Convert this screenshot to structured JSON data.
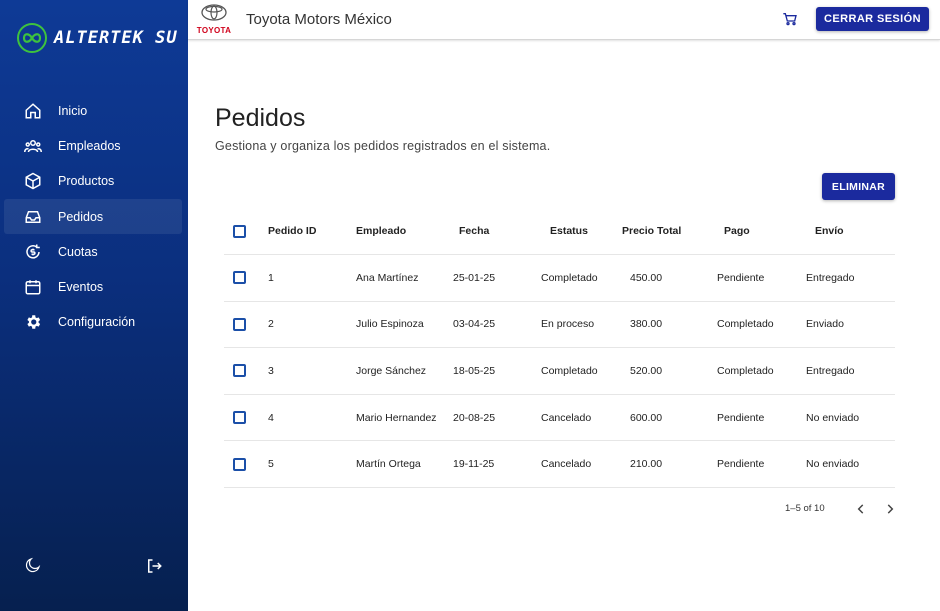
{
  "sidebar": {
    "logo_text": "ALTERTEK SU",
    "items": [
      {
        "label": "Inicio",
        "icon": "home-icon"
      },
      {
        "label": "Empleados",
        "icon": "people-icon"
      },
      {
        "label": "Productos",
        "icon": "box-icon"
      },
      {
        "label": "Pedidos",
        "icon": "inbox-icon",
        "active": true
      },
      {
        "label": "Cuotas",
        "icon": "dollar-refresh-icon"
      },
      {
        "label": "Eventos",
        "icon": "calendar-icon"
      },
      {
        "label": "Configuración",
        "icon": "gear-icon"
      }
    ]
  },
  "topbar": {
    "brand_word": "TOYOTA",
    "title": "Toyota Motors México",
    "logout_label": "CERRAR SESIÓN"
  },
  "main": {
    "title": "Pedidos",
    "subtitle": "Gestiona y organiza los pedidos registrados en el sistema.",
    "delete_label": "ELIMINAR"
  },
  "table": {
    "headers": [
      "Pedido ID",
      "Empleado",
      "Fecha",
      "Estatus",
      "Precio Total",
      "Pago",
      "Envío"
    ],
    "rows": [
      [
        "1",
        "Ana Martínez",
        "25-01-25",
        "Completado",
        "450.00",
        "Pendiente",
        "Entregado"
      ],
      [
        "2",
        "Julio Espinoza",
        "03-04-25",
        "En proceso",
        "380.00",
        "Completado",
        "Enviado"
      ],
      [
        "3",
        "Jorge Sánchez",
        "18-05-25",
        "Completado",
        "520.00",
        "Completado",
        "Entregado"
      ],
      [
        "4",
        "Mario Hernandez",
        "20-08-25",
        "Cancelado",
        "600.00",
        "Pendiente",
        "No enviado"
      ],
      [
        "5",
        "Martín Ortega",
        "19-11-25",
        "Cancelado",
        "210.00",
        "Pendiente",
        "No enviado"
      ]
    ]
  },
  "pagination": {
    "range": "1–5 of 10"
  },
  "colors": {
    "primary": "#1b2a9e",
    "sidebar_top": "#0e3a96",
    "sidebar_bottom": "#06204f",
    "brand_red": "#d0021b",
    "logo_green": "#3ec23e"
  }
}
